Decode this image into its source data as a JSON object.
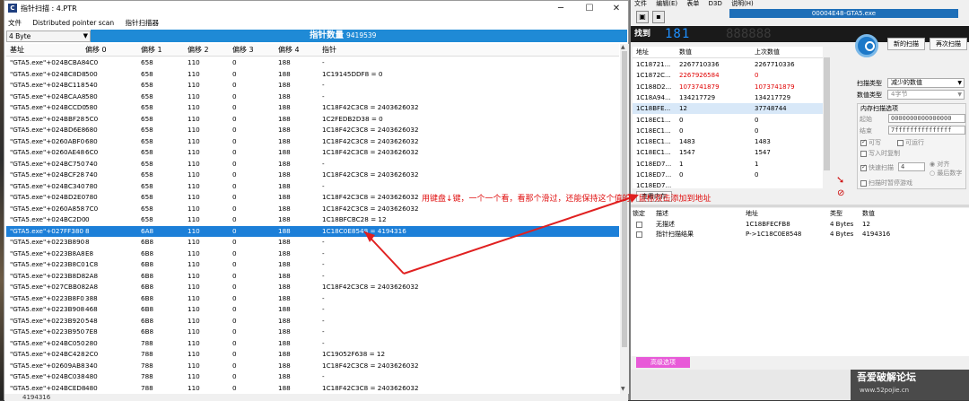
{
  "pointer_scan": {
    "title": "指针扫描 : 4.PTR",
    "menu": [
      "文件",
      "Distributed pointer scan",
      "指针扫描器"
    ],
    "type_select": "4 Byte",
    "banner_label": "指针数量",
    "banner_count": "9419539",
    "columns": [
      "基址",
      "偏移 0",
      "偏移 1",
      "偏移 2",
      "偏移 3",
      "偏移 4",
      "指针"
    ],
    "rows": [
      [
        "\"GTA5.exe\"+024BCBA8",
        "4C0",
        "658",
        "110",
        "0",
        "188",
        "-"
      ],
      [
        "\"GTA5.exe\"+024BC8D8",
        "500",
        "658",
        "110",
        "0",
        "188",
        "1C19145DDF8 = 0"
      ],
      [
        "\"GTA5.exe\"+024BC118",
        "540",
        "658",
        "110",
        "0",
        "188",
        "-"
      ],
      [
        "\"GTA5.exe\"+024BCAA8",
        "580",
        "658",
        "110",
        "0",
        "188",
        "-"
      ],
      [
        "\"GTA5.exe\"+024BCCD0",
        "580",
        "658",
        "110",
        "0",
        "188",
        "1C18F42C3C8 = 2403626032"
      ],
      [
        "\"GTA5.exe\"+024BBF28",
        "5C0",
        "658",
        "110",
        "0",
        "188",
        "1C2FEDB2D38 = 0"
      ],
      [
        "\"GTA5.exe\"+024BD6E8",
        "680",
        "658",
        "110",
        "0",
        "188",
        "1C18F42C3C8 = 2403626032"
      ],
      [
        "\"GTA5.exe\"+0260ABF0",
        "680",
        "658",
        "110",
        "0",
        "188",
        "1C18F42C3C8 = 2403626032"
      ],
      [
        "\"GTA5.exe\"+0260AE48",
        "6C0",
        "658",
        "110",
        "0",
        "188",
        "1C18F42C3C8 = 2403626032"
      ],
      [
        "\"GTA5.exe\"+024BC750",
        "740",
        "658",
        "110",
        "0",
        "188",
        "-"
      ],
      [
        "\"GTA5.exe\"+024BCF28",
        "740",
        "658",
        "110",
        "0",
        "188",
        "1C18F42C3C8 = 2403626032"
      ],
      [
        "\"GTA5.exe\"+024BC340",
        "780",
        "658",
        "110",
        "0",
        "188",
        "-"
      ],
      [
        "\"GTA5.exe\"+024BD2E0",
        "780",
        "658",
        "110",
        "0",
        "188",
        "1C18F42C3C8 = 2403626032"
      ],
      [
        "\"GTA5.exe\"+0260A858",
        "7C0",
        "658",
        "110",
        "0",
        "188",
        "1C18F42C3C8 = 2403626032"
      ],
      [
        "\"GTA5.exe\"+024BC2D0",
        "0",
        "658",
        "110",
        "0",
        "188",
        "1C18BFCBC28 = 12"
      ],
      [
        "\"GTA5.exe\"+027FF380",
        "8",
        "6A8",
        "110",
        "0",
        "188",
        "1C18C0E8548 = 4194316"
      ],
      [
        "\"GTA5.exe\"+0223B890",
        "8",
        "6B8",
        "110",
        "0",
        "188",
        "-"
      ],
      [
        "\"GTA5.exe\"+0223B8A8",
        "E8",
        "6B8",
        "110",
        "0",
        "188",
        "-"
      ],
      [
        "\"GTA5.exe\"+0223B8C0",
        "1C8",
        "6B8",
        "110",
        "0",
        "188",
        "-"
      ],
      [
        "\"GTA5.exe\"+0223B8D8",
        "2A8",
        "6B8",
        "110",
        "0",
        "188",
        "-"
      ],
      [
        "\"GTA5.exe\"+027CBB08",
        "2A8",
        "6B8",
        "110",
        "0",
        "188",
        "1C18F42C3C8 = 2403626032"
      ],
      [
        "\"GTA5.exe\"+0223B8F0",
        "388",
        "6B8",
        "110",
        "0",
        "188",
        "-"
      ],
      [
        "\"GTA5.exe\"+0223B908",
        "468",
        "6B8",
        "110",
        "0",
        "188",
        "-"
      ],
      [
        "\"GTA5.exe\"+0223B920",
        "548",
        "6B8",
        "110",
        "0",
        "188",
        "-"
      ],
      [
        "\"GTA5.exe\"+0223B950",
        "7E8",
        "6B8",
        "110",
        "0",
        "188",
        "-"
      ],
      [
        "\"GTA5.exe\"+024BC050",
        "280",
        "788",
        "110",
        "0",
        "188",
        "-"
      ],
      [
        "\"GTA5.exe\"+024BC428",
        "2C0",
        "788",
        "110",
        "0",
        "188",
        "1C19052F638 = 12"
      ],
      [
        "\"GTA5.exe\"+02609AB8",
        "340",
        "788",
        "110",
        "0",
        "188",
        "1C18F42C3C8 = 2403626032"
      ],
      [
        "\"GTA5.exe\"+024BC038",
        "480",
        "788",
        "110",
        "0",
        "188",
        "-"
      ],
      [
        "\"GTA5.exe\"+024BCED8",
        "480",
        "788",
        "110",
        "0",
        "188",
        "1C18F42C3C8 = 2403626032"
      ]
    ],
    "selected_row": 15,
    "status_text": "4194316"
  },
  "annotation": "用键盘↓键，一个一个看，看那个滑过，还能保持这个值的，鼠标双击添加到地址",
  "cheat_engine": {
    "menu": [
      "文件",
      "编辑(E)",
      "表单",
      "D3D",
      "说明(H)"
    ],
    "process": "00004E48-GTA5.exe",
    "find_label": "找到",
    "found_digits": "181",
    "dim_digits": "888888",
    "list_columns": [
      "地址",
      "数值",
      "上次数值"
    ],
    "list_rows": [
      {
        "addr": "1C18721...",
        "val": "2267710336",
        "prev": "2267710336",
        "red": false
      },
      {
        "addr": "1C1872C...",
        "val": "2267926584",
        "prev": "0",
        "red": true
      },
      {
        "addr": "1C188D2...",
        "val": "1073741879",
        "prev": "1073741879",
        "red": true
      },
      {
        "addr": "1C18A94...",
        "val": "134217729",
        "prev": "134217729",
        "red": false
      },
      {
        "addr": "1C18BFE...",
        "val": "12",
        "prev": "37748744",
        "red": false
      },
      {
        "addr": "1C18EC1...",
        "val": "0",
        "prev": "0",
        "red": false
      },
      {
        "addr": "1C18EC1...",
        "val": "0",
        "prev": "0",
        "red": false
      },
      {
        "addr": "1C18EC1...",
        "val": "1483",
        "prev": "1483",
        "red": false
      },
      {
        "addr": "1C18EC1...",
        "val": "1547",
        "prev": "1547",
        "red": false
      },
      {
        "addr": "1C18ED7...",
        "val": "1",
        "prev": "1",
        "red": false
      },
      {
        "addr": "1C18ED7...",
        "val": "0",
        "prev": "0",
        "red": false
      },
      {
        "addr": "1C18ED7...",
        "val": "",
        "prev": "",
        "red": false
      }
    ],
    "new_scan": "新的扫描",
    "next_scan": "再次扫描",
    "scan_type_label": "扫描类型",
    "scan_type": "减少的数值",
    "value_type_label": "数值类型",
    "value_type": "4字节",
    "mem_options": "内存扫描选项",
    "start_label": "起始",
    "start_val": "0000000000000000",
    "stop_label": "结束",
    "stop_val": "7fffffffffffffff",
    "writable": "可写",
    "executable": "可运行",
    "copy_on_write": "写入时复制",
    "fast_scan": "快速扫描",
    "fast_val": "4",
    "align": "对齐",
    "last_digits": "最后数字",
    "pause_scan": "扫描时暂停游戏",
    "view_memory": "查看内存",
    "addr_columns": [
      "锁定",
      "描述",
      "地址",
      "类型",
      "数值"
    ],
    "addr_rows": [
      {
        "desc": "无描述",
        "addr": "1C18BFECFB8",
        "type": "4 Bytes",
        "val": "12"
      },
      {
        "desc": "指针扫描结果",
        "addr": "P->1C18C0E8548",
        "type": "4 Bytes",
        "val": "4194316"
      }
    ],
    "advanced": "高级选项"
  },
  "watermark": {
    "name": "吾爱破解论坛",
    "url": "www.52pojie.cn"
  }
}
